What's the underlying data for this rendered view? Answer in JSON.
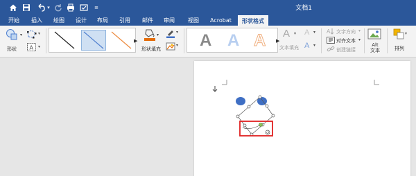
{
  "window": {
    "title": "文档1"
  },
  "tabs": [
    {
      "label": "开始"
    },
    {
      "label": "插入"
    },
    {
      "label": "绘图"
    },
    {
      "label": "设计"
    },
    {
      "label": "布局"
    },
    {
      "label": "引用"
    },
    {
      "label": "邮件"
    },
    {
      "label": "审阅"
    },
    {
      "label": "视图"
    },
    {
      "label": "Acrobat"
    },
    {
      "label": "形状格式"
    }
  ],
  "ribbon": {
    "shapes_label": "形状",
    "shape_fill_label": "形状填充",
    "wordart_letter": "A",
    "text_fill_label": "文本填充",
    "text_direction_label": "文字方向",
    "align_text_label": "对齐文本",
    "create_link_label": "创建链接",
    "alt_text_label": "Alt\n文本",
    "arrange_label": "排列"
  },
  "colors": {
    "brand_blue": "#2b579a",
    "highlight_red": "#e02020",
    "ellipse_blue": "#3f6fc4",
    "fill_orange": "#e46c0a",
    "line_orange": "#ed8b3f",
    "line_blue": "#4f7fcf"
  }
}
